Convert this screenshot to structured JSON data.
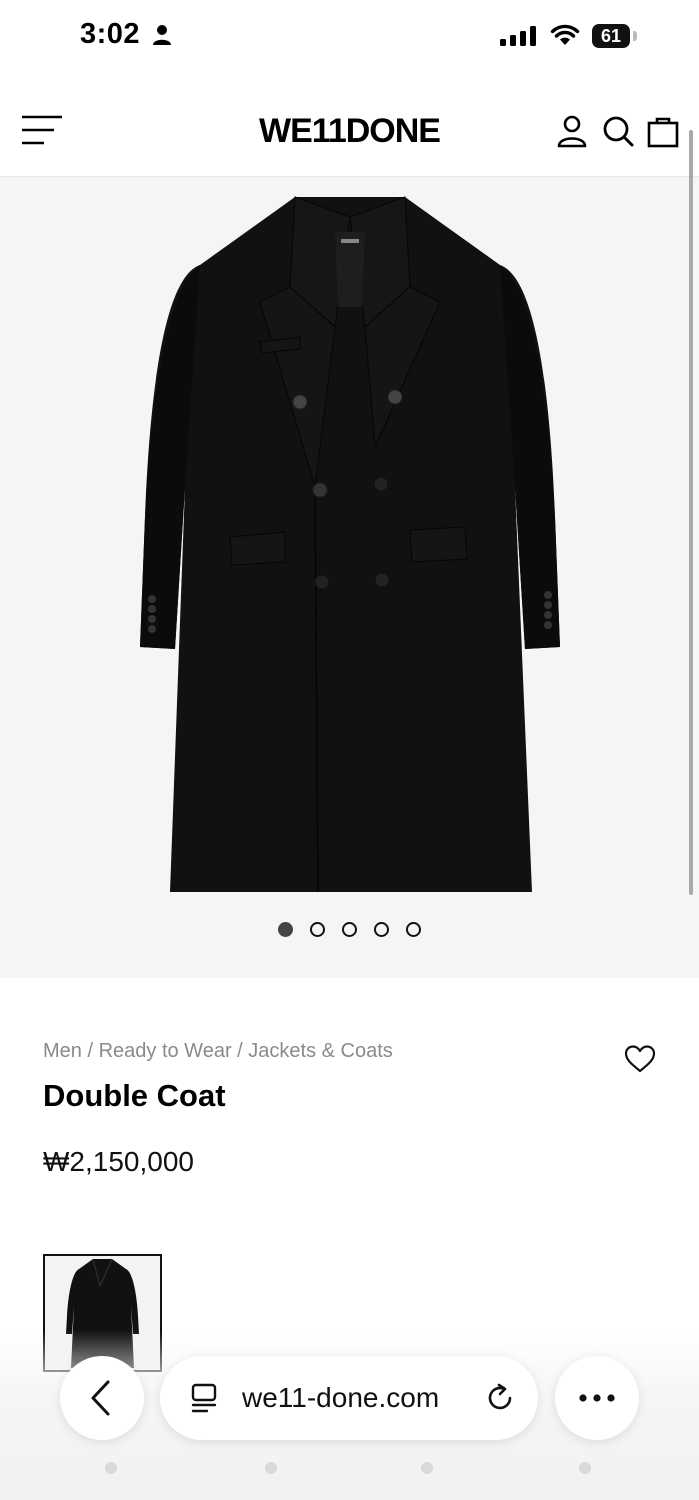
{
  "status_bar": {
    "time": "3:02",
    "battery": "61"
  },
  "header": {
    "logo": "WE11DONE"
  },
  "gallery": {
    "slide_count": 5,
    "active_index": 0
  },
  "product": {
    "breadcrumb": "Men / Ready to Wear / Jackets & Coats",
    "name": "Double Coat",
    "price": "₩2,150,000"
  },
  "browser": {
    "url": "we11-done.com"
  },
  "colors": {
    "coat": "#111111",
    "gallery_bg": "#f5f5f5",
    "muted_text": "#8a8a8a"
  }
}
